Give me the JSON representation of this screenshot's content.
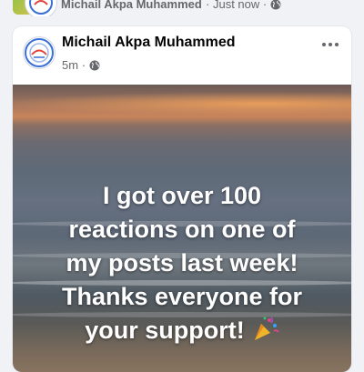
{
  "shared_header": {
    "author": "Michail Akpa Muhammed",
    "timestamp": "Just now",
    "separator": "·",
    "privacy_icon": "globe-icon"
  },
  "post": {
    "author": "Michail Akpa Muhammed",
    "timestamp": "5m",
    "separator": "·",
    "privacy_icon": "globe-icon",
    "more_icon": "more-options-icon",
    "text_lines": [
      "I got over 100",
      "reactions on one of",
      "my posts last week!",
      "Thanks everyone for",
      "your support!"
    ],
    "emoji_icon": "party-popper-icon"
  },
  "colors": {
    "text_primary": "#050505",
    "text_secondary": "#65676b",
    "background": "#f0f2f5",
    "card": "#ffffff"
  }
}
